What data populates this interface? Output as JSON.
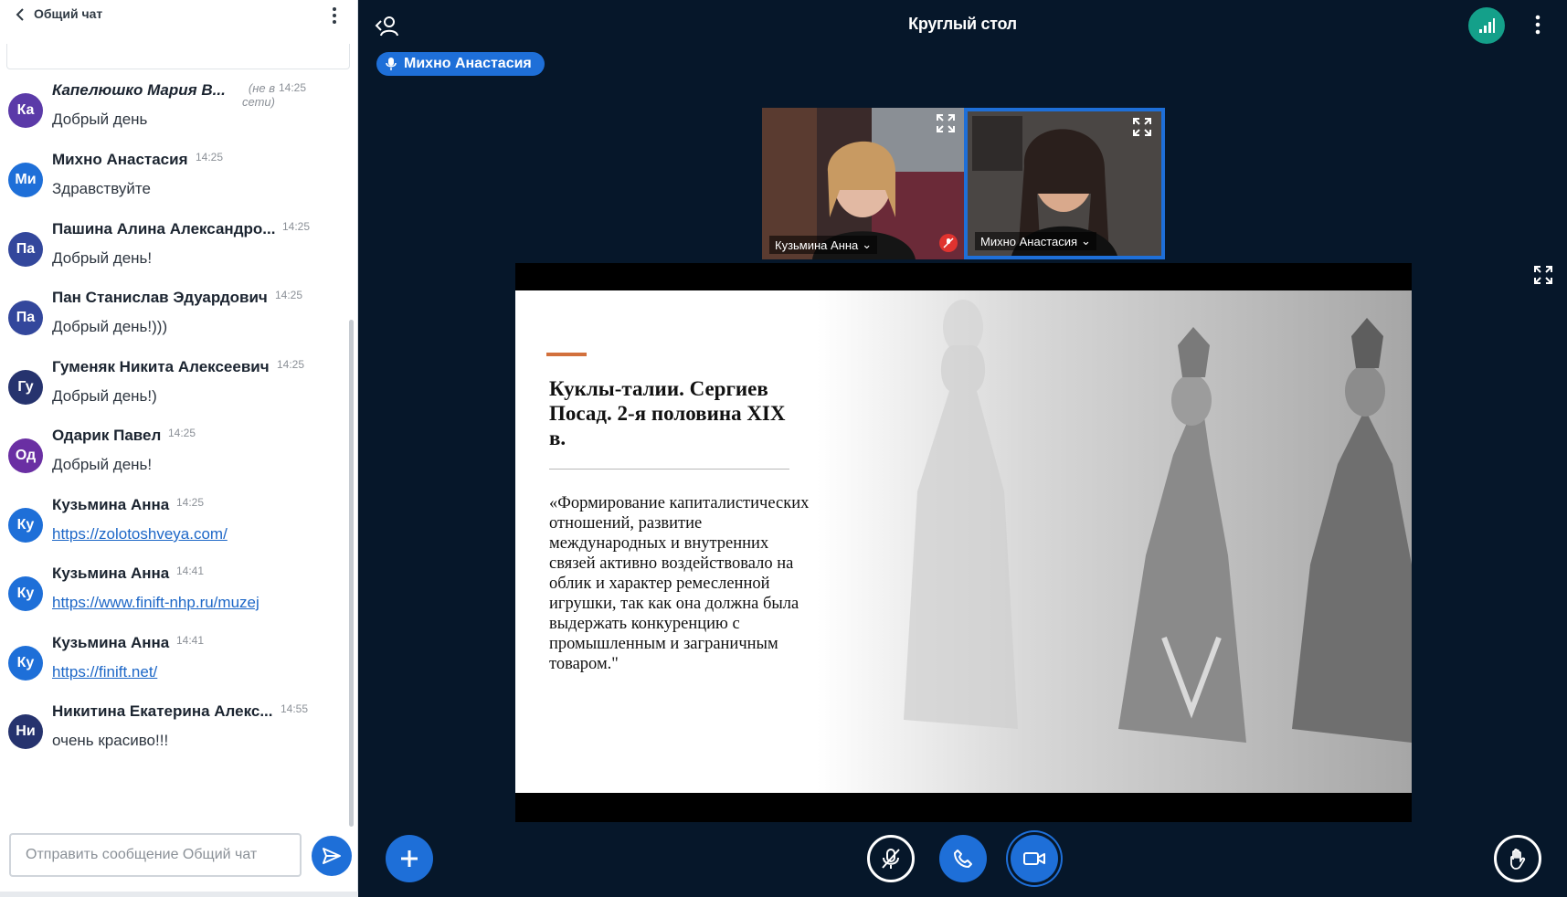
{
  "chat": {
    "title": "Общий чат",
    "input_placeholder": "Отправить сообщение Общий чат",
    "messages": [
      {
        "initials": "Ка",
        "name": "Капелюшко Мария В...",
        "time": "14:25",
        "status": "(не в сети)",
        "text": "Добрый день",
        "link": false,
        "avatar_color": "#5b3aa8",
        "italic": true
      },
      {
        "initials": "Ми",
        "name": "Михно Анастасия",
        "time": "14:25",
        "text": "Здравствуйте",
        "link": false,
        "avatar_color": "#1e6fd8"
      },
      {
        "initials": "Па",
        "name": "Пашина Алина Александро...",
        "time": "14:25",
        "text": "Добрый день!",
        "link": false,
        "avatar_color": "#33479c"
      },
      {
        "initials": "Па",
        "name": "Пан Станислав Эдуардович",
        "time": "14:25",
        "text": "Добрый день!)))",
        "link": false,
        "avatar_color": "#33479c"
      },
      {
        "initials": "Гу",
        "name": "Гуменяк Никита Алексеевич",
        "time": "14:25",
        "text": "Добрый день!)",
        "link": false,
        "avatar_color": "#26336e"
      },
      {
        "initials": "Од",
        "name": "Одарик Павел",
        "time": "14:25",
        "text": "Добрый день!",
        "link": false,
        "avatar_color": "#6a2fa3"
      },
      {
        "initials": "Ку",
        "name": "Кузьмина Анна",
        "time": "14:25",
        "text": "https://zolotoshveya.com/",
        "link": true,
        "avatar_color": "#1e6fd8"
      },
      {
        "initials": "Ку",
        "name": "Кузьмина Анна",
        "time": "14:41",
        "text": "https://www.finift-nhp.ru/muzej",
        "link": true,
        "avatar_color": "#1e6fd8"
      },
      {
        "initials": "Ку",
        "name": "Кузьмина Анна",
        "time": "14:41",
        "text": "https://finift.net/",
        "link": true,
        "avatar_color": "#1e6fd8"
      },
      {
        "initials": "Ни",
        "name": "Никитина Екатерина Алекс...",
        "time": "14:55",
        "text": "очень красиво!!!",
        "link": false,
        "avatar_color": "#26336e"
      }
    ]
  },
  "meeting": {
    "title": "Круглый стол",
    "talking": "Михно Анастасия"
  },
  "videos": [
    {
      "name": "Кузьмина Анна",
      "muted": true
    },
    {
      "name": "Михно Анастасия",
      "muted": false,
      "active": true
    }
  ],
  "slide": {
    "title": "Куклы-талии. Сергиев Посад. 2-я половина XIX в.",
    "quote": "«Формирование капиталистических отношений, развитие международных и внутренних связей активно воздействовало на облик и характер ремесленной игрушки, так как она должна была выдержать конкуренцию с промышленным и заграничным товаром.\""
  },
  "colors": {
    "accent": "#1e6fd8",
    "background": "#06172a",
    "connection": "#14a08a",
    "slide_accent": "#d2703c",
    "mute_red": "#e0332f"
  },
  "icons": [
    "chevron-left-icon",
    "kebab-icon",
    "send-icon",
    "users-icon",
    "signal-icon",
    "mic-icon",
    "fullscreen-icon",
    "plus-icon",
    "phone-icon",
    "video-icon",
    "hand-icon"
  ]
}
